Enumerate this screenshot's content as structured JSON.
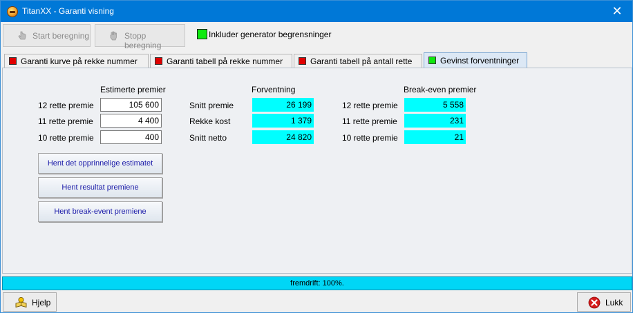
{
  "window": {
    "title": "TitanXX - Garanti visning",
    "close": "✕"
  },
  "toolbar": {
    "start_label": "Start beregning",
    "stop_label": "Stopp beregning",
    "include_label": "Inkluder generator begrensninger"
  },
  "tabs": [
    {
      "label": "Garanti kurve på rekke nummer",
      "color": "#e00000"
    },
    {
      "label": "Garanti tabell på rekke nummer",
      "color": "#e00000"
    },
    {
      "label": "Garanti tabell på antall rette",
      "color": "#e00000"
    },
    {
      "label": "Gevinst forventninger",
      "color": "#0ee80e",
      "active": true
    }
  ],
  "estimates": {
    "header": "Estimerte premier",
    "rows": [
      {
        "label": "12 rette premie",
        "value": "105 600"
      },
      {
        "label": "11 rette premie",
        "value": "4 400"
      },
      {
        "label": "10 rette premie",
        "value": "400"
      }
    ]
  },
  "expectation": {
    "header": "Forventning",
    "rows": [
      {
        "label": "Snitt premie",
        "value": "26 199"
      },
      {
        "label": "Rekke kost",
        "value": "1 379"
      },
      {
        "label": "Snitt netto",
        "value": "24 820"
      }
    ]
  },
  "breakeven": {
    "header": "Break-even premier",
    "rows": [
      {
        "label": "12 rette premie",
        "value": "5 558"
      },
      {
        "label": "11 rette premie",
        "value": "231"
      },
      {
        "label": "10 rette premie",
        "value": "21"
      }
    ]
  },
  "actions": {
    "original": "Hent det opprinnelige estimatet",
    "result": "Hent resultat premiene",
    "breakeven": "Hent break-event premiene"
  },
  "progress": {
    "text": "fremdrift: 100%.",
    "fraction": 1.0
  },
  "footer": {
    "help_label": "Hjelp",
    "close_label": "Lukk"
  }
}
